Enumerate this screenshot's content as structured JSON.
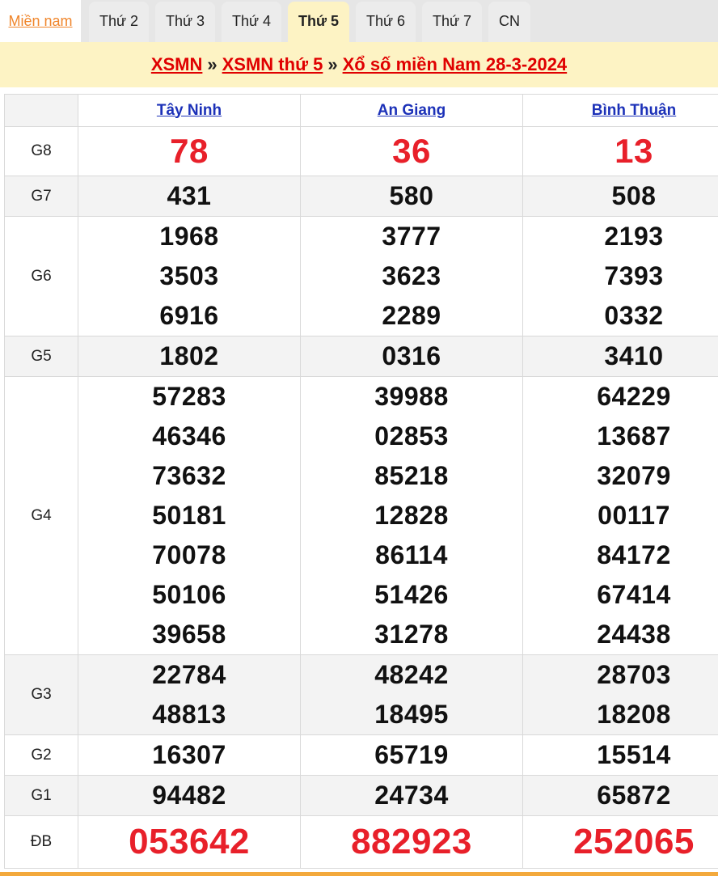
{
  "tabs": [
    {
      "label": "Miền nam",
      "active": false,
      "home": true
    },
    {
      "label": "Thứ 2",
      "active": false
    },
    {
      "label": "Thứ 3",
      "active": false
    },
    {
      "label": "Thứ 4",
      "active": false
    },
    {
      "label": "Thứ 5",
      "active": true
    },
    {
      "label": "Thứ 6",
      "active": false
    },
    {
      "label": "Thứ 7",
      "active": false
    },
    {
      "label": "CN",
      "active": false
    }
  ],
  "breadcrumb": {
    "item1": "XSMN",
    "item2": "XSMN thứ 5",
    "item3": "Xổ số miền Nam 28-3-2024",
    "separator": "»"
  },
  "provinces": [
    "Tây Ninh",
    "An Giang",
    "Bình Thuận"
  ],
  "prizes": [
    {
      "label": "G8",
      "values": [
        [
          "78"
        ],
        [
          "36"
        ],
        [
          "13"
        ]
      ]
    },
    {
      "label": "G7",
      "values": [
        [
          "431"
        ],
        [
          "580"
        ],
        [
          "508"
        ]
      ]
    },
    {
      "label": "G6",
      "values": [
        [
          "1968",
          "3503",
          "6916"
        ],
        [
          "3777",
          "3623",
          "2289"
        ],
        [
          "2193",
          "7393",
          "0332"
        ]
      ]
    },
    {
      "label": "G5",
      "values": [
        [
          "1802"
        ],
        [
          "0316"
        ],
        [
          "3410"
        ]
      ]
    },
    {
      "label": "G4",
      "values": [
        [
          "57283",
          "46346",
          "73632",
          "50181",
          "70078",
          "50106",
          "39658"
        ],
        [
          "39988",
          "02853",
          "85218",
          "12828",
          "86114",
          "51426",
          "31278"
        ],
        [
          "64229",
          "13687",
          "32079",
          "00117",
          "84172",
          "67414",
          "24438"
        ]
      ]
    },
    {
      "label": "G3",
      "values": [
        [
          "22784",
          "48813"
        ],
        [
          "48242",
          "18495"
        ],
        [
          "28703",
          "18208"
        ]
      ]
    },
    {
      "label": "G2",
      "values": [
        [
          "16307"
        ],
        [
          "65719"
        ],
        [
          "15514"
        ]
      ]
    },
    {
      "label": "G1",
      "values": [
        [
          "94482"
        ],
        [
          "24734"
        ],
        [
          "65872"
        ]
      ]
    },
    {
      "label": "ĐB",
      "values": [
        [
          "053642"
        ],
        [
          "882923"
        ],
        [
          "252065"
        ]
      ]
    }
  ],
  "colors": {
    "accent_red": "#e8202a",
    "link_blue": "#1c31b8",
    "banner_bg": "#fdf3c4",
    "home_orange": "#f0862c"
  }
}
